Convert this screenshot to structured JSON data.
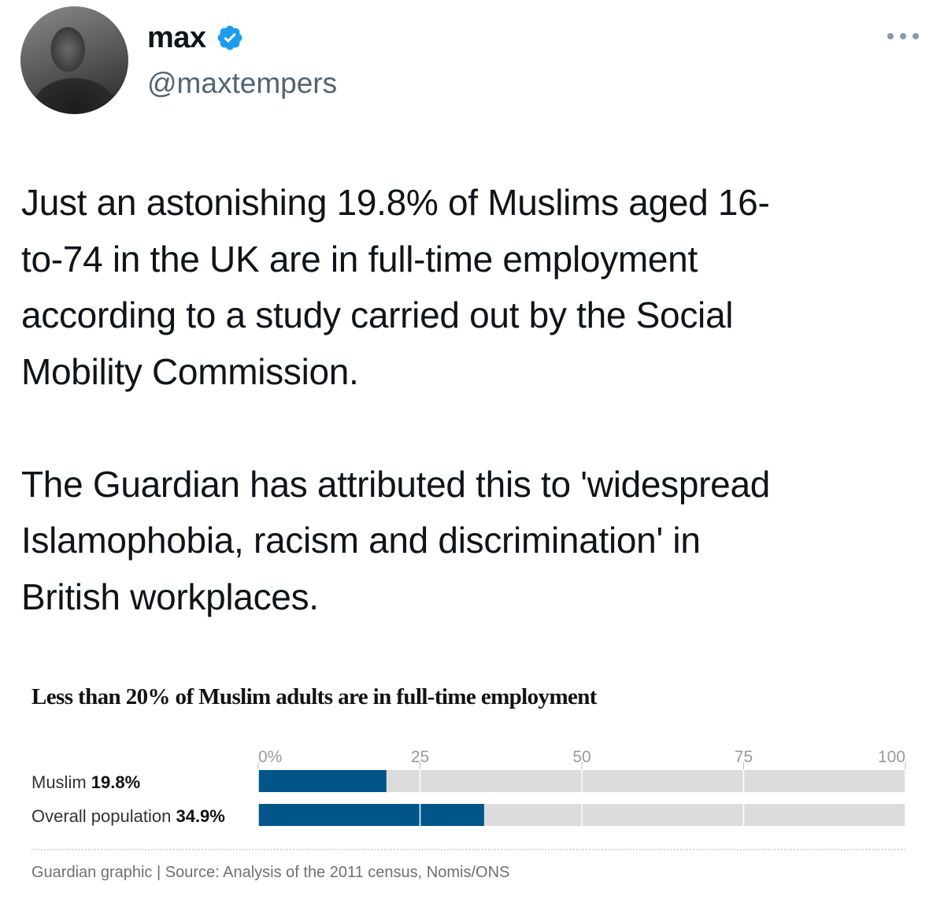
{
  "author": {
    "name": "max",
    "handle": "@maxtempers",
    "verified": true,
    "badge_color": "#1d9bf0"
  },
  "tweet": {
    "text": "Just an astonishing 19.8% of Muslims aged 16-\nto-74 in the UK are in full-time employment\naccording to a study carried out by the Social\nMobility Commission.\n\nThe Guardian has attributed this to 'widespread\nIslamophobia, racism and discrimination' in\nBritish workplaces."
  },
  "icons": {
    "more": "more-options-icon",
    "verified": "verified-badge-icon"
  },
  "chart_data": {
    "type": "bar",
    "orientation": "horizontal",
    "title": "Less than 20% of Muslim adults are in full-time employment",
    "categories": [
      "Muslim",
      "Overall population"
    ],
    "value_labels": [
      "19.8%",
      "34.9%"
    ],
    "values": [
      19.8,
      34.9
    ],
    "xlim": [
      0,
      100
    ],
    "ticks": [
      "0%",
      "25",
      "50",
      "75",
      "100"
    ],
    "tick_values": [
      0,
      25,
      50,
      75,
      100
    ],
    "grid": true,
    "bar_color": "#005689",
    "track_color": "#dcdcdc",
    "source": "Guardian graphic | Source: Analysis of the 2011 census, Nomis/ONS"
  }
}
